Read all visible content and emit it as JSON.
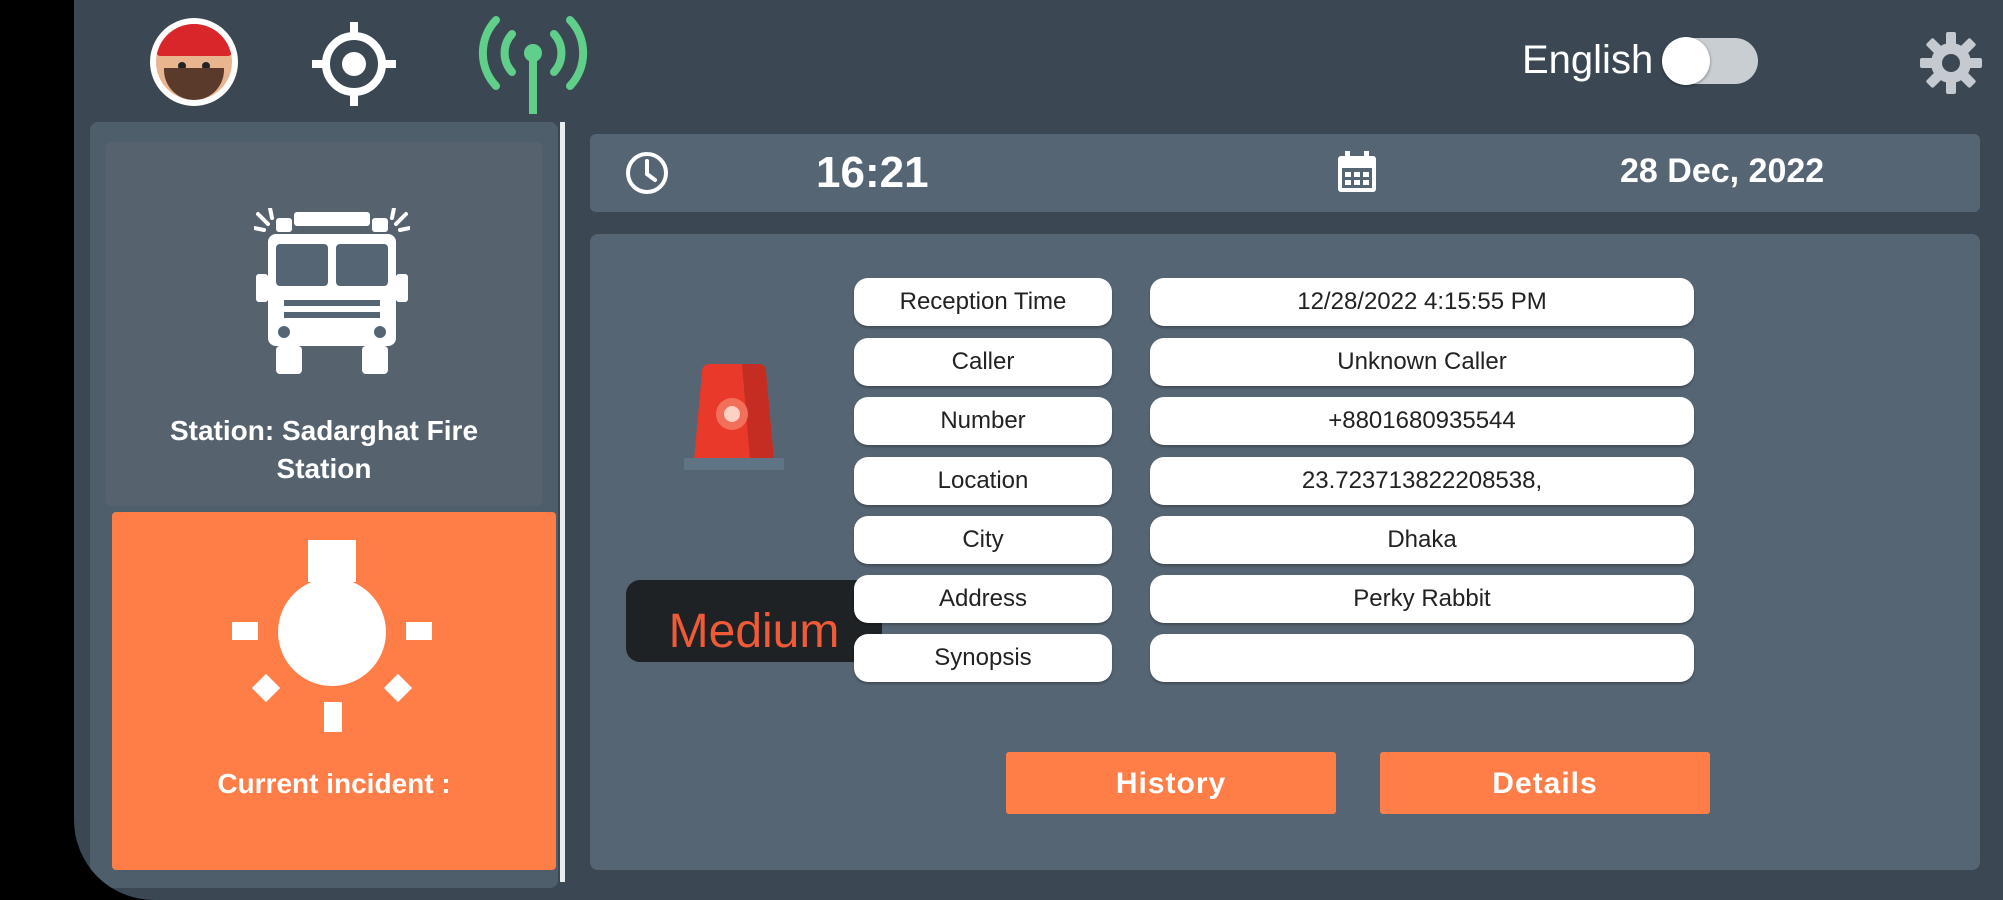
{
  "header": {
    "language_label": "English",
    "language_toggle_on": false
  },
  "sidebar": {
    "station_label": "Station: Sadarghat Fire Station",
    "incident_label": "Current incident :"
  },
  "datetime": {
    "time": "16:21",
    "date": "28 Dec, 2022"
  },
  "incident": {
    "severity": "Medium",
    "fields": [
      {
        "label": "Reception Time",
        "value": "12/28/2022 4:15:55 PM"
      },
      {
        "label": "Caller",
        "value": "Unknown Caller"
      },
      {
        "label": "Number",
        "value": "+8801680935544"
      },
      {
        "label": "Location",
        "value": "23.723713822208538,"
      },
      {
        "label": "City",
        "value": "Dhaka"
      },
      {
        "label": "Address",
        "value": "Perky Rabbit"
      },
      {
        "label": "Synopsis",
        "value": ""
      }
    ]
  },
  "actions": {
    "history_label": "History",
    "details_label": "Details"
  },
  "colors": {
    "accent": "#ff7e47",
    "signal_green": "#5fcf8a",
    "background": "#3b4853",
    "severity_text": "#f05a36"
  },
  "icons": [
    "avatar",
    "target-icon",
    "signal-icon",
    "gear-icon",
    "fire-truck-icon",
    "bulb-icon",
    "clock-icon",
    "calendar-icon",
    "siren-icon"
  ]
}
